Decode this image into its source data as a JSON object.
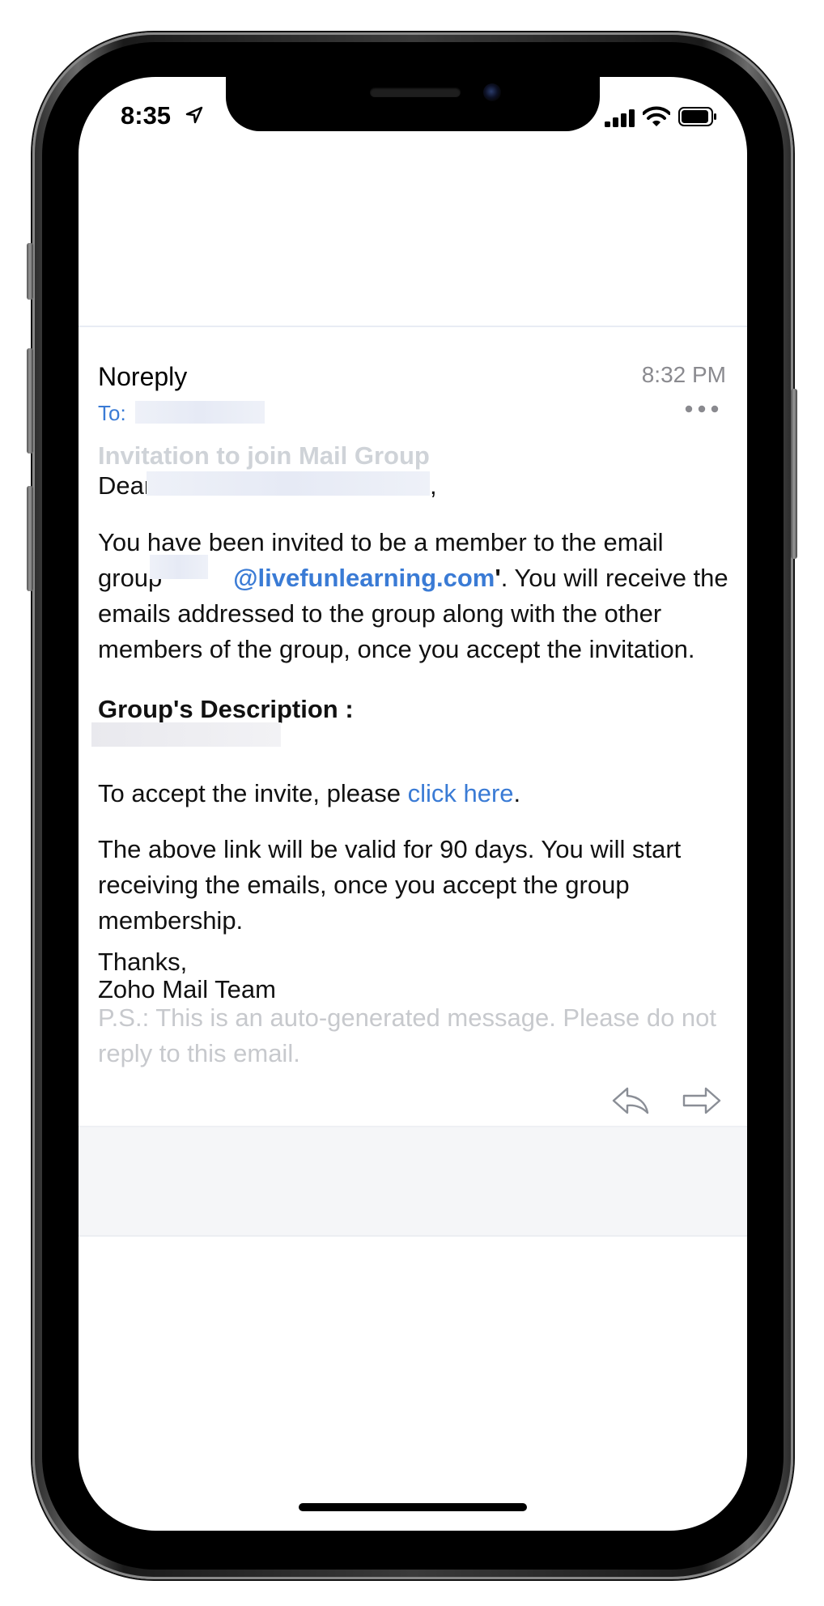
{
  "status_bar": {
    "time": "8:35"
  },
  "message": {
    "sender": "Noreply",
    "time": "8:32 PM",
    "to_label": "To:",
    "subject": "Invitation to join Mail Group",
    "greeting": "Dear",
    "greeting_end": ",",
    "para1_a": "You have been invited to be a member to the email group",
    "para1_quote_open": "'",
    "para1_domain": "@livefunlearning.com",
    "para1_quote_close": "'",
    "para1_b": ". You will receive the emails addressed to the group along with the other members of the group, once you accept the invitation.",
    "desc_heading": "Group's Description :",
    "accept_a": "To accept the invite, please",
    "accept_link": "click here",
    "accept_end": ".",
    "validity": "The above link will be valid for 90 days. You will start receiving the emails, once you accept the group membership.",
    "thanks": "Thanks,",
    "signature": "Zoho Mail Team",
    "ps": "P.S.: This is an auto-generated message. Please do not reply to this email."
  },
  "colors": {
    "accent": "#3a7bd5",
    "muted": "#8a8a8f",
    "ps": "#c7c9cd"
  },
  "icons": [
    "location-arrow-icon",
    "signal-icon",
    "wifi-icon",
    "battery-icon",
    "more-icon",
    "reply-icon",
    "forward-icon"
  ]
}
